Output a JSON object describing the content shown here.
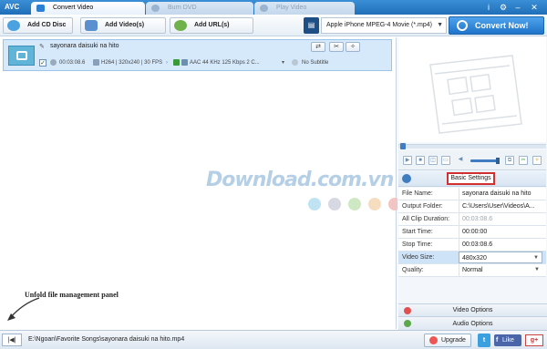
{
  "app": {
    "logo": "AVC"
  },
  "tabs": [
    {
      "label": "Convert Video",
      "active": true
    },
    {
      "label": "Burn DVD",
      "active": false
    },
    {
      "label": "Play Video",
      "active": false
    }
  ],
  "window_controls": {
    "info": "i",
    "settings": "⚙",
    "minimize": "–",
    "close": "✕"
  },
  "toolbar": {
    "add_cd_label": "Add CD Disc",
    "add_video_label": "Add Video(s)",
    "add_url_label": "Add URL(s)",
    "profile_value": "Apple iPhone MPEG-4 Movie (*.mp4)",
    "convert_label": "Convert Now!"
  },
  "file": {
    "name": "sayonara daisuki na hito",
    "duration": "00:03:08.6",
    "video_info": "H264 | 320x240 | 30 FPS",
    "audio_info": "AAC 44 KHz 125 Kbps 2 C...",
    "subtitle": "No Subtitle"
  },
  "hint": {
    "unfold_label": "Unfold file management panel"
  },
  "statusbar": {
    "output_path": "E:\\Ngoan\\Favorite Songs\\sayonara daisuki na hito.mp4",
    "upgrade_label": "Upgrade",
    "like_label": "Like"
  },
  "settings": {
    "tab_label": "Basic Settings",
    "rows": [
      {
        "label": "File Name:",
        "value": "sayonara daisuki na hito"
      },
      {
        "label": "Output Folder:",
        "value": "C:\\Users\\User\\Videos\\A..."
      },
      {
        "label": "All Clip Duration:",
        "value": "00:03:08.6"
      },
      {
        "label": "Start Time:",
        "value": "00:00:00"
      },
      {
        "label": "Stop Time:",
        "value": "00:03:08.6"
      },
      {
        "label": "Video Size:",
        "value": "480x320"
      },
      {
        "label": "Quality:",
        "value": "Normal"
      }
    ],
    "video_options_label": "Video Options",
    "audio_options_label": "Audio Options"
  },
  "watermark": {
    "text": "Download.com.vn"
  },
  "colors": {
    "accent": "#1f6fb8",
    "highlight_border": "#d23030",
    "selected_row": "#cfe3f8"
  }
}
